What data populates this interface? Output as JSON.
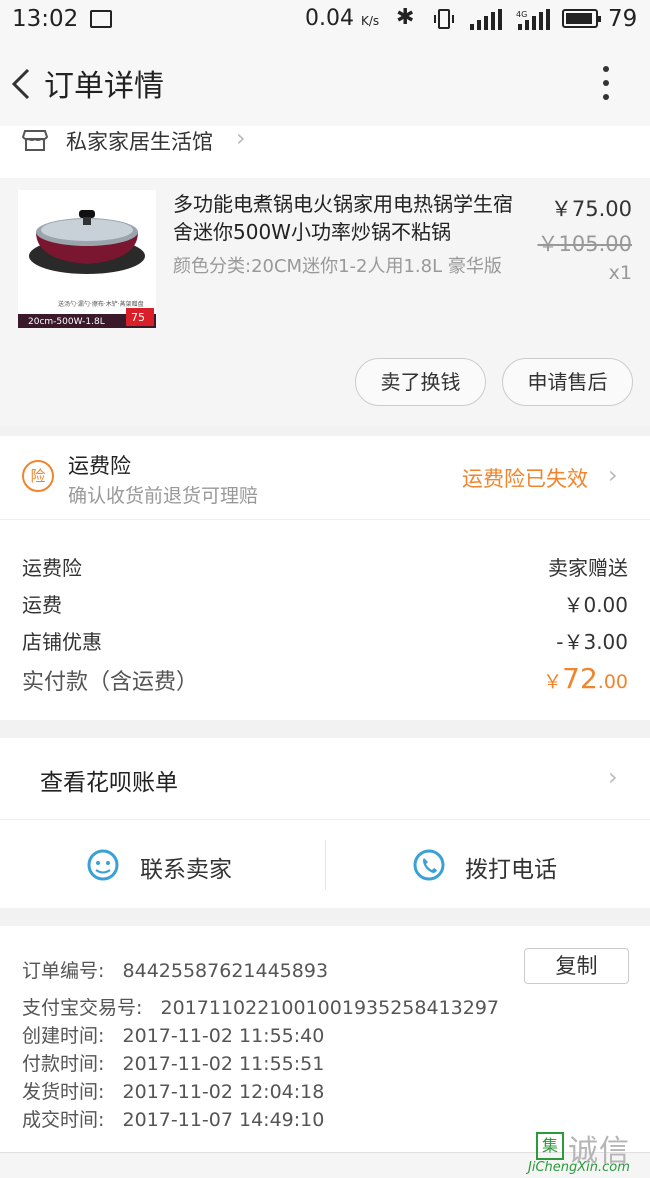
{
  "status_bar": {
    "time": "13:02",
    "speed": "0.04",
    "speed_unit": "K/s",
    "battery": "79"
  },
  "header": {
    "title": "订单详情"
  },
  "shop": {
    "name": "私家家居生活馆"
  },
  "product": {
    "name": "多功能电煮锅电火锅家用电热锅学生宿舍迷你500W小功率炒锅不粘锅",
    "variant": "颜色分类:20CM迷你1-2人用1.8L 豪华版",
    "price": "￥75.00",
    "original_price": "￥105.00",
    "quantity": "x1",
    "image_caption": "20cm-500W-1.8L",
    "image_badge": "75",
    "buttons": {
      "sell": "卖了换钱",
      "after_sale": "申请售后"
    }
  },
  "insurance": {
    "title": "运费险",
    "subtitle": "确认收货前退货可理赔",
    "status": "运费险已失效",
    "icon_char": "险"
  },
  "fees": {
    "rows": [
      {
        "label": "运费险",
        "value": "卖家赠送"
      },
      {
        "label": "运费",
        "value": "￥0.00"
      },
      {
        "label": "店铺优惠",
        "value": "-￥3.00"
      }
    ],
    "total_label": "实付款（含运费）",
    "total_currency": "￥",
    "total_int": "72",
    "total_dec": ".00"
  },
  "huabei": {
    "label": "查看花呗账单"
  },
  "contact": {
    "seller": "联系卖家",
    "phone": "拨打电话"
  },
  "order_info": {
    "rows": [
      {
        "label": "订单编号:",
        "value": "84425587621445893"
      },
      {
        "label": "支付宝交易号:",
        "value": "2017110221001001935258413297"
      },
      {
        "label": "创建时间:",
        "value": "2017-11-02 11:55:40"
      },
      {
        "label": "付款时间:",
        "value": "2017-11-02 11:55:51"
      },
      {
        "label": "发货时间:",
        "value": "2017-11-02 12:04:18"
      },
      {
        "label": "成交时间:",
        "value": "2017-11-07 14:49:10"
      }
    ],
    "copy_label": "复制"
  },
  "watermark": {
    "mark": "集",
    "text": "诚信",
    "url": "JiChengXin.com"
  },
  "colors": {
    "accent": "#f0852e",
    "link_blue": "#3aa0d8",
    "watermark_green": "#2a9a3a"
  },
  "icons": [
    "back-icon",
    "more-icon",
    "shop-icon",
    "chevron-right-icon",
    "insurance-icon",
    "chat-icon",
    "phone-icon",
    "bluetooth-icon",
    "signal-icon",
    "battery-icon"
  ]
}
